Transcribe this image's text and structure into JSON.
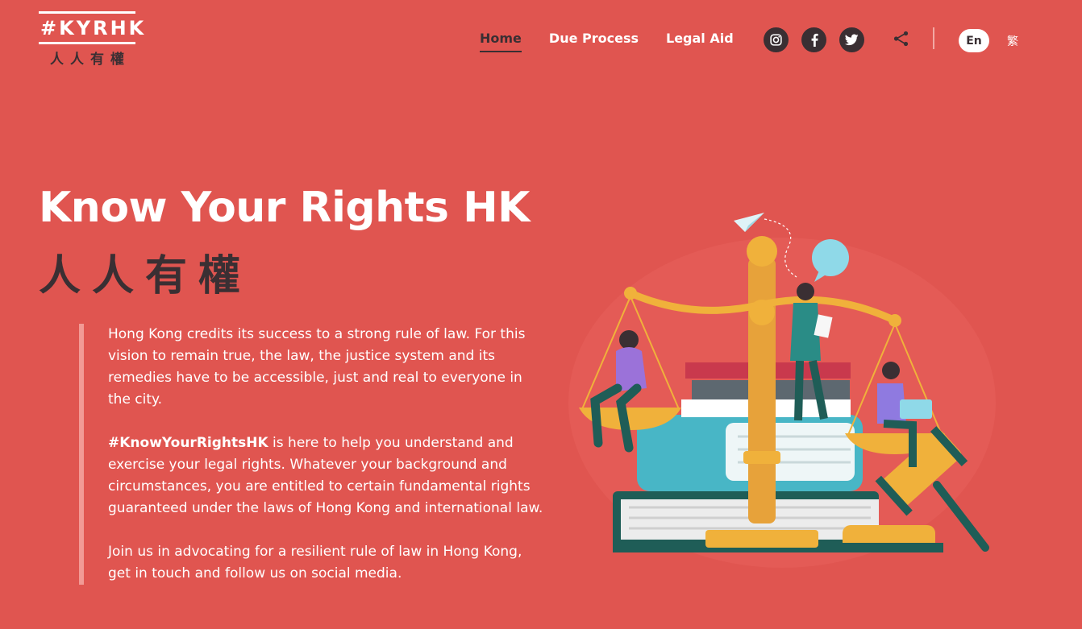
{
  "logo": {
    "hashtag": "#KYRHK",
    "chinese": "人人有權"
  },
  "nav": {
    "items": [
      {
        "label": "Home",
        "active": true
      },
      {
        "label": "Due Process",
        "active": false
      },
      {
        "label": "Legal Aid",
        "active": false
      }
    ]
  },
  "social": {
    "icons": [
      "instagram-icon",
      "facebook-icon",
      "twitter-icon",
      "share-icon"
    ]
  },
  "language": {
    "en": "En",
    "zh": "繁",
    "selected": "En"
  },
  "hero": {
    "title": "Know Your Rights HK",
    "title_cn": "人人有權",
    "paragraph1": "Hong Kong credits its success to a strong rule of law. For this vision to remain true, the law, the justice system and its remedies have to be accessible, just and real to everyone in the city.",
    "hashtag": "#KnowYourRightsHK",
    "paragraph2_rest": " is here to help you understand and exercise your legal rights. Whatever your background and circumstances, you are entitled to certain fundamental rights guaranteed under the laws of Hong Kong and international law.",
    "paragraph3": "Join us in advocating for a resilient rule of law in Hong Kong, get in touch and follow us on social media."
  },
  "colors": {
    "background": "#e05550",
    "dark": "#3a2f33",
    "accent_bar": "#f29a95",
    "gold": "#f0b13b",
    "teal": "#2a8c86"
  }
}
